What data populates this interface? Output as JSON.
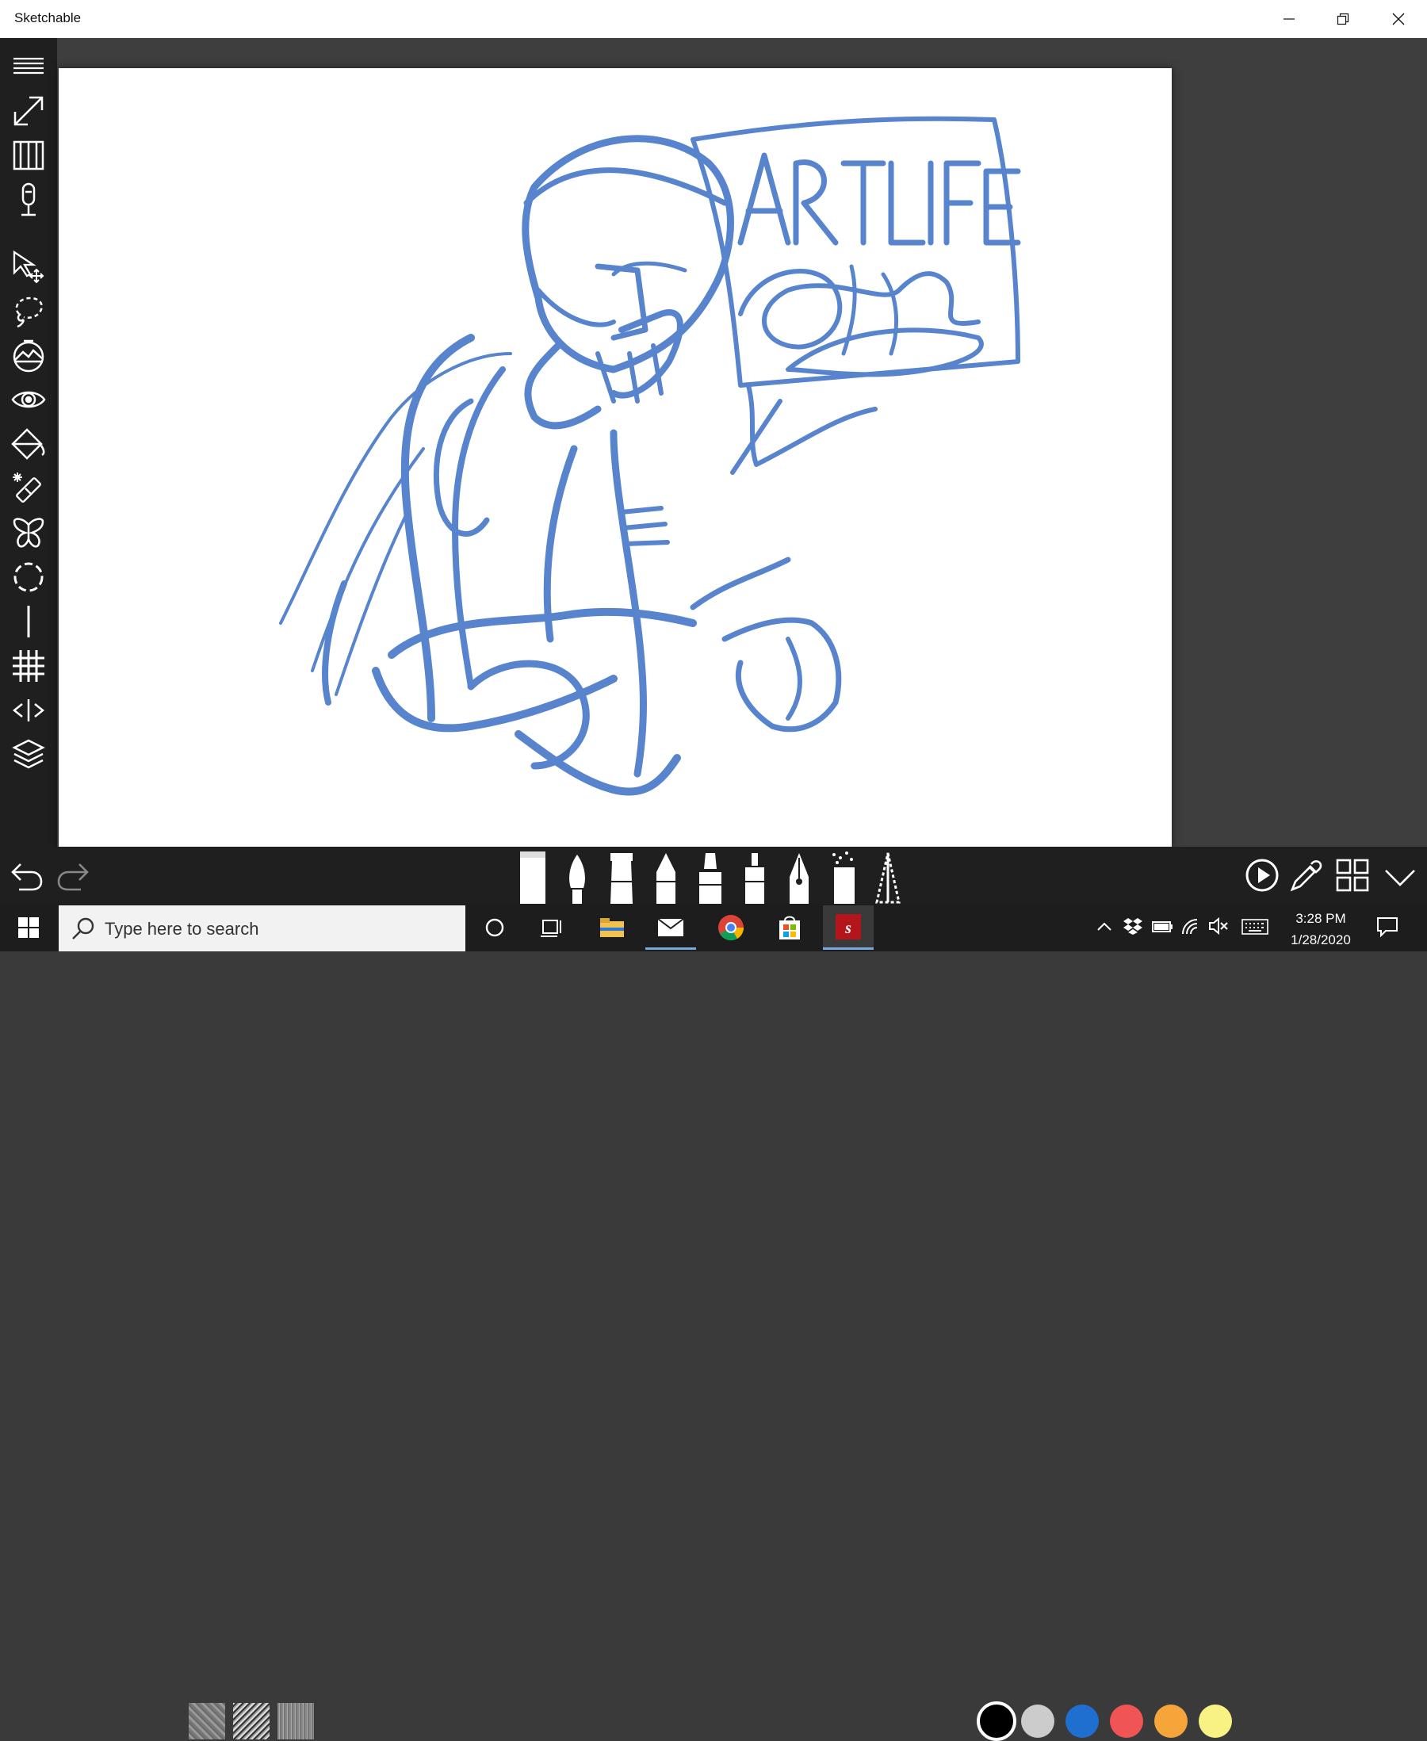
{
  "window": {
    "title": "Sketchable"
  },
  "sidebar": {
    "tools": [
      {
        "name": "menu-icon"
      },
      {
        "name": "fullscreen-icon"
      },
      {
        "name": "journal-icon"
      },
      {
        "name": "microphone-icon"
      },
      {
        "name": "select-move-icon"
      },
      {
        "name": "lasso-icon"
      },
      {
        "name": "image-insert-icon"
      },
      {
        "name": "visibility-icon"
      },
      {
        "name": "fill-bucket-icon"
      },
      {
        "name": "magic-eraser-icon"
      },
      {
        "name": "symmetry-icon"
      },
      {
        "name": "circle-guide-icon"
      },
      {
        "name": "line-guide-icon"
      },
      {
        "name": "grid-guide-icon"
      },
      {
        "name": "mirror-icon"
      },
      {
        "name": "layers-icon"
      }
    ]
  },
  "bottombar": {
    "colors": [
      "#000000",
      "#cccccc",
      "#1e6fd0",
      "#f05454",
      "#f5a53a",
      "#f7f283"
    ],
    "stroke_color": "#3a6fc4"
  },
  "taskbar": {
    "search_placeholder": "Type here to search",
    "time": "3:28 PM",
    "date": "1/28/2020"
  }
}
